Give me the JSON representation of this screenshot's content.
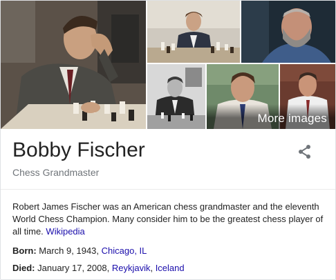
{
  "gallery": {
    "more_images_label": "More images"
  },
  "entity": {
    "name": "Bobby Fischer",
    "subtitle": "Chess Grandmaster"
  },
  "description": {
    "text": "Robert James Fischer was an American chess grandmaster and the eleventh World Chess Champion. Many consider him to be the greatest chess player of all time.",
    "source_link": "Wikipedia"
  },
  "facts": {
    "born": {
      "label": "Born:",
      "date": "March 9, 1943,",
      "place": "Chicago, IL"
    },
    "died": {
      "label": "Died:",
      "date": "January 17, 2008,",
      "city": "Reykjavik",
      "country": "Iceland"
    }
  },
  "icons": {
    "share": "share-icon"
  },
  "colors": {
    "link": "#1a0dab",
    "subtitle": "#70757a",
    "border": "#dfe1e5"
  }
}
